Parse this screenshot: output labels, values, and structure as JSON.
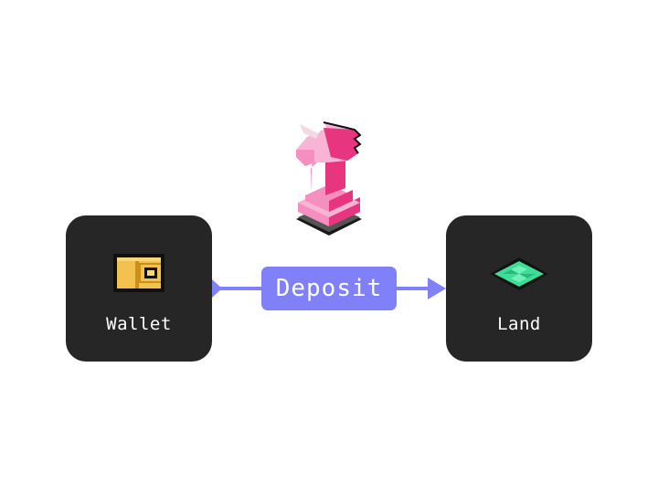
{
  "nodes": {
    "source": {
      "label": "Wallet",
      "icon": "wallet-icon"
    },
    "target": {
      "label": "Land",
      "icon": "land-tile-icon"
    }
  },
  "action": {
    "label": "Deposit",
    "color": "#8080f8"
  },
  "mascot": {
    "icon": "pink-unicorn-knight-icon"
  },
  "colors": {
    "node_bg": "#262626",
    "wallet": "#f2c14e",
    "land": "#3ddc97",
    "knight": "#f0449b"
  }
}
